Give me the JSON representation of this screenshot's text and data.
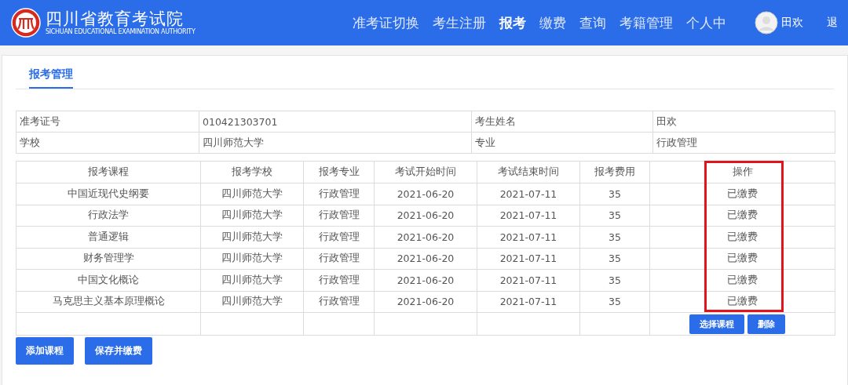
{
  "header": {
    "logo_title": "四川省教育考试院",
    "logo_subtitle": "SICHUAN EDUCATIONAL EXAMINATION AUTHORITY",
    "nav": [
      {
        "label": "准考证切换",
        "selected": false
      },
      {
        "label": "考生注册",
        "selected": false
      },
      {
        "label": "报考",
        "selected": true
      },
      {
        "label": "缴费",
        "selected": false
      },
      {
        "label": "查询",
        "selected": false
      },
      {
        "label": "考籍管理",
        "selected": false
      },
      {
        "label": "个人中",
        "selected": false
      }
    ],
    "user_name": "田欢",
    "logout": "退"
  },
  "tab": {
    "label": "报考管理",
    "selected": true
  },
  "info": [
    {
      "label": "准考证号",
      "value": "010421303701"
    },
    {
      "label": "考生姓名",
      "value": "田欢"
    },
    {
      "label": "学校",
      "value": "四川师范大学"
    },
    {
      "label": "专业",
      "value": "行政管理"
    }
  ],
  "table": {
    "columns": [
      "报考课程",
      "报考学校",
      "报考专业",
      "考试开始时间",
      "考试结束时间",
      "报考费用",
      "操作"
    ],
    "rows": [
      [
        "中国近现代史纲要",
        "四川师范大学",
        "行政管理",
        "2021-06-20",
        "2021-07-11",
        "35",
        "已缴费"
      ],
      [
        "行政法学",
        "四川师范大学",
        "行政管理",
        "2021-06-20",
        "2021-07-11",
        "35",
        "已缴费"
      ],
      [
        "普通逻辑",
        "四川师范大学",
        "行政管理",
        "2021-06-20",
        "2021-07-11",
        "35",
        "已缴费"
      ],
      [
        "财务管理学",
        "四川师范大学",
        "行政管理",
        "2021-06-20",
        "2021-07-11",
        "35",
        "已缴费"
      ],
      [
        "中国文化概论",
        "四川师范大学",
        "行政管理",
        "2021-06-20",
        "2021-07-11",
        "35",
        "已缴费"
      ],
      [
        "马克思主义基本原理概论",
        "四川师范大学",
        "行政管理",
        "2021-06-20",
        "2021-07-11",
        "35",
        "已缴费"
      ]
    ],
    "row_buttons": [
      "选择课程",
      "删除"
    ]
  },
  "buttons": [
    "添加课程",
    "保存并缴费"
  ]
}
